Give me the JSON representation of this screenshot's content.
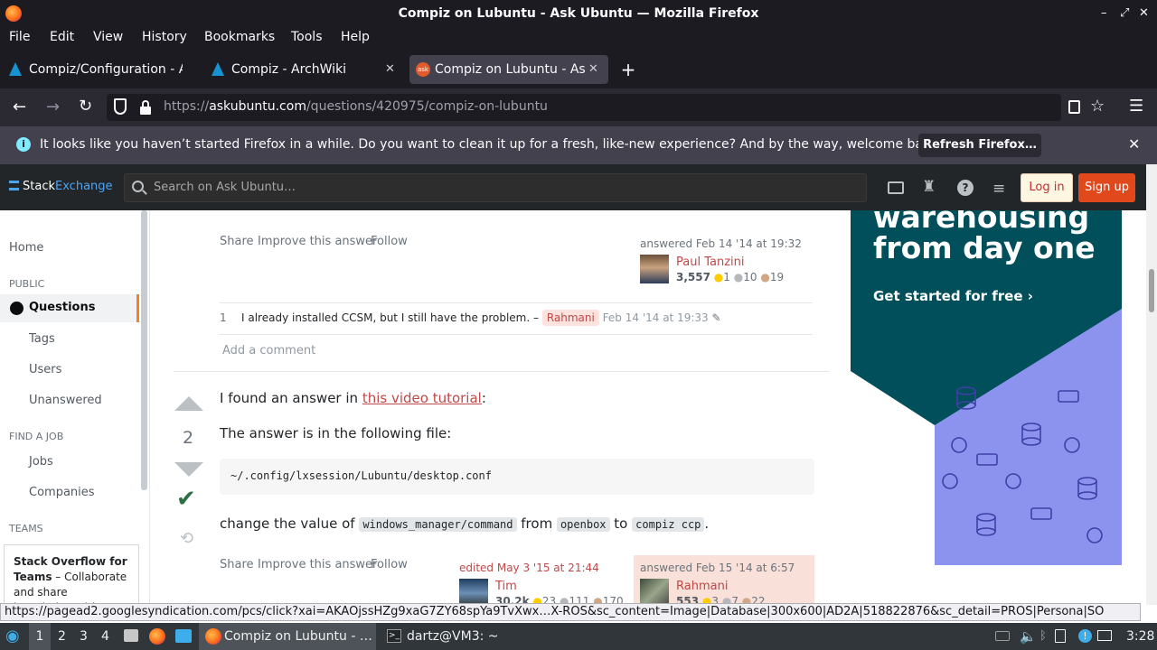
{
  "window": {
    "title": "Compiz on Lubuntu - Ask Ubuntu — Mozilla Firefox",
    "minimize": "–",
    "maximize": "⤢",
    "close": "✕"
  },
  "menu": [
    "File",
    "Edit",
    "View",
    "History",
    "Bookmarks",
    "Tools",
    "Help"
  ],
  "tabs": [
    {
      "title": "Compiz/Configuration - A",
      "icon": "archwiki-icon"
    },
    {
      "title": "Compiz - ArchWiki",
      "icon": "archwiki-icon"
    },
    {
      "title": "Compiz on Lubuntu - Ask",
      "icon": "askubuntu-icon",
      "active": true
    }
  ],
  "newtab": "+",
  "url": {
    "prefix": "https://",
    "domain": "askubuntu.com",
    "path": "/questions/420975/compiz-on-lubuntu"
  },
  "notification": {
    "text": "It looks like you haven’t started Firefox in a while. Do you want to clean it up for a fresh, like-new experience? And by the way, welcome back!",
    "button": "Refresh Firefox…"
  },
  "se": {
    "logo_a": "Stack",
    "logo_b": "Exchange",
    "search_placeholder": "Search on Ask Ubuntu…",
    "login": "Log in",
    "signup": "Sign up"
  },
  "leftnav": {
    "home": "Home",
    "public": "PUBLIC",
    "questions": "Questions",
    "tags": "Tags",
    "users": "Users",
    "unanswered": "Unanswered",
    "find_job": "FIND A JOB",
    "jobs": "Jobs",
    "companies": "Companies",
    "teams": "TEAMS",
    "teams_title": "Stack Overflow for Teams",
    "teams_text": " – Collaborate and share knowledge with a private group."
  },
  "answer1": {
    "actions": {
      "share": "Share",
      "improve": "Improve this answer",
      "follow": "Follow"
    },
    "answered": "answered Feb 14 '14 at 19:32",
    "user": "Paul Tanzini",
    "rep": "3,557",
    "gold": "1",
    "silver": "10",
    "bronze": "19",
    "comment": {
      "score": "1",
      "text": "I already installed CCSM, but I still have the problem. –",
      "user": "Rahmani",
      "date": "Feb 14 '14 at 19:33"
    },
    "add_comment": "Add a comment"
  },
  "answer2": {
    "votes": "2",
    "p1_pre": "I found an answer in ",
    "p1_link": "this video tutorial",
    "p1_post": ":",
    "p2": "The answer is in the following file:",
    "code": "~/.config/lxsession/Lubuntu/desktop.conf",
    "p3_pre": "change the value of ",
    "p3_c1": "windows_manager/command",
    "p3_mid": " from ",
    "p3_c2": "openbox",
    "p3_mid2": " to ",
    "p3_c3": "compiz ccp",
    "p3_post": ".",
    "actions": {
      "share": "Share",
      "improve": "Improve this answer",
      "follow": "Follow"
    },
    "edited": "edited May 3 '15 at 21:44",
    "editor": "Tim",
    "editor_rep": "30.2k",
    "editor_gold": "23",
    "editor_silver": "111",
    "editor_bronze": "170",
    "answered": "answered Feb 15 '14 at 6:57",
    "user": "Rahmani",
    "rep": "553",
    "gold": "3",
    "silver": "7",
    "bronze": "22"
  },
  "ad": {
    "line1": "warehousing",
    "line2": "from day one",
    "cta": "Get started for free ›"
  },
  "status_url": "https://pagead2.googlesyndication.com/pcs/click?xai=AKAOjssHZg9xaG7ZY68spYa9TvXwx…X-ROS&sc_content=Image|Database|300x600|AD2A|518822876&sc_detail=PROS|Persona|SO",
  "taskbar": {
    "desktops": [
      "1",
      "2",
      "3",
      "4"
    ],
    "task1": "Compiz on Lubuntu - …",
    "task2": "dartz@VM3: ~",
    "clock": "3:28"
  },
  "colors": {
    "accent": "#f48225",
    "link": "#c04848",
    "firefox_dark": "#1c1b22",
    "signup": "#e1491c",
    "ad_teal": "#004f5a",
    "ad_purple": "#8c93ee"
  }
}
